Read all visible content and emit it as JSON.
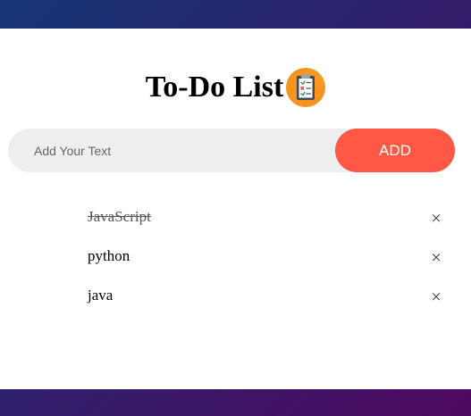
{
  "app": {
    "title": "To-Do List",
    "title_icon": "clipboard-checklist-icon"
  },
  "input": {
    "placeholder": "Add Your Text",
    "value": ""
  },
  "add_button": {
    "label": "ADD"
  },
  "tasks": [
    {
      "text": "JavaScript",
      "checked": true
    },
    {
      "text": "python",
      "checked": false
    },
    {
      "text": "java",
      "checked": false
    }
  ],
  "delete_icon": {
    "glyph": "×",
    "name": "close-icon"
  },
  "colors": {
    "accent": "#ff5945",
    "input_bg": "#edeef0",
    "gradient_start": "#153677",
    "gradient_end": "#4e085f"
  }
}
